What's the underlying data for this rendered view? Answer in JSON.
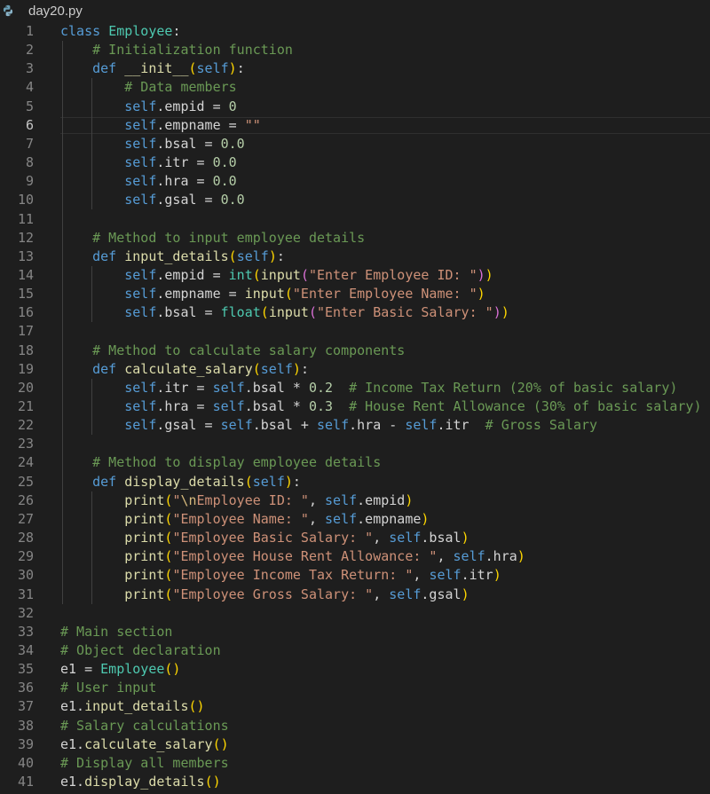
{
  "tab": {
    "filename": "day20.py",
    "icon": "python-icon"
  },
  "editor": {
    "language": "python",
    "active_line": 6,
    "lines": [
      {
        "n": "1",
        "tokens": [
          [
            "kw",
            "class"
          ],
          [
            "plain",
            " "
          ],
          [
            "cls",
            "Employee"
          ],
          [
            "plain",
            ":"
          ]
        ]
      },
      {
        "n": "2",
        "tokens": [
          [
            "plain",
            "    "
          ],
          [
            "cmt",
            "# Initialization function"
          ]
        ]
      },
      {
        "n": "3",
        "tokens": [
          [
            "plain",
            "    "
          ],
          [
            "kw",
            "def"
          ],
          [
            "plain",
            " "
          ],
          [
            "fn",
            "__init__"
          ],
          [
            "p1",
            "("
          ],
          [
            "slf",
            "self"
          ],
          [
            "p1",
            ")"
          ],
          [
            "plain",
            ":"
          ]
        ]
      },
      {
        "n": "4",
        "tokens": [
          [
            "plain",
            "        "
          ],
          [
            "cmt",
            "# Data members"
          ]
        ]
      },
      {
        "n": "5",
        "tokens": [
          [
            "plain",
            "        "
          ],
          [
            "slf",
            "self"
          ],
          [
            "plain",
            ".empid = "
          ],
          [
            "num",
            "0"
          ]
        ]
      },
      {
        "n": "6",
        "tokens": [
          [
            "plain",
            "        "
          ],
          [
            "slf",
            "self"
          ],
          [
            "plain",
            ".empname = "
          ],
          [
            "str",
            "\"\""
          ]
        ]
      },
      {
        "n": "7",
        "tokens": [
          [
            "plain",
            "        "
          ],
          [
            "slf",
            "self"
          ],
          [
            "plain",
            ".bsal = "
          ],
          [
            "num",
            "0.0"
          ]
        ]
      },
      {
        "n": "8",
        "tokens": [
          [
            "plain",
            "        "
          ],
          [
            "slf",
            "self"
          ],
          [
            "plain",
            ".itr = "
          ],
          [
            "num",
            "0.0"
          ]
        ]
      },
      {
        "n": "9",
        "tokens": [
          [
            "plain",
            "        "
          ],
          [
            "slf",
            "self"
          ],
          [
            "plain",
            ".hra = "
          ],
          [
            "num",
            "0.0"
          ]
        ]
      },
      {
        "n": "10",
        "tokens": [
          [
            "plain",
            "        "
          ],
          [
            "slf",
            "self"
          ],
          [
            "plain",
            ".gsal = "
          ],
          [
            "num",
            "0.0"
          ]
        ]
      },
      {
        "n": "11",
        "tokens": []
      },
      {
        "n": "12",
        "tokens": [
          [
            "plain",
            "    "
          ],
          [
            "cmt",
            "# Method to input employee details"
          ]
        ]
      },
      {
        "n": "13",
        "tokens": [
          [
            "plain",
            "    "
          ],
          [
            "kw",
            "def"
          ],
          [
            "plain",
            " "
          ],
          [
            "fn",
            "input_details"
          ],
          [
            "p1",
            "("
          ],
          [
            "slf",
            "self"
          ],
          [
            "p1",
            ")"
          ],
          [
            "plain",
            ":"
          ]
        ]
      },
      {
        "n": "14",
        "tokens": [
          [
            "plain",
            "        "
          ],
          [
            "slf",
            "self"
          ],
          [
            "plain",
            ".empid = "
          ],
          [
            "bi",
            "int"
          ],
          [
            "p1",
            "("
          ],
          [
            "fn",
            "input"
          ],
          [
            "p2",
            "("
          ],
          [
            "str",
            "\"Enter Employee ID: \""
          ],
          [
            "p2",
            ")"
          ],
          [
            "p1",
            ")"
          ]
        ]
      },
      {
        "n": "15",
        "tokens": [
          [
            "plain",
            "        "
          ],
          [
            "slf",
            "self"
          ],
          [
            "plain",
            ".empname = "
          ],
          [
            "fn",
            "input"
          ],
          [
            "p1",
            "("
          ],
          [
            "str",
            "\"Enter Employee Name: \""
          ],
          [
            "p1",
            ")"
          ]
        ]
      },
      {
        "n": "16",
        "tokens": [
          [
            "plain",
            "        "
          ],
          [
            "slf",
            "self"
          ],
          [
            "plain",
            ".bsal = "
          ],
          [
            "bi",
            "float"
          ],
          [
            "p1",
            "("
          ],
          [
            "fn",
            "input"
          ],
          [
            "p2",
            "("
          ],
          [
            "str",
            "\"Enter Basic Salary: \""
          ],
          [
            "p2",
            ")"
          ],
          [
            "p1",
            ")"
          ]
        ]
      },
      {
        "n": "17",
        "tokens": []
      },
      {
        "n": "18",
        "tokens": [
          [
            "plain",
            "    "
          ],
          [
            "cmt",
            "# Method to calculate salary components"
          ]
        ]
      },
      {
        "n": "19",
        "tokens": [
          [
            "plain",
            "    "
          ],
          [
            "kw",
            "def"
          ],
          [
            "plain",
            " "
          ],
          [
            "fn",
            "calculate_salary"
          ],
          [
            "p1",
            "("
          ],
          [
            "slf",
            "self"
          ],
          [
            "p1",
            ")"
          ],
          [
            "plain",
            ":"
          ]
        ]
      },
      {
        "n": "20",
        "tokens": [
          [
            "plain",
            "        "
          ],
          [
            "slf",
            "self"
          ],
          [
            "plain",
            ".itr = "
          ],
          [
            "slf",
            "self"
          ],
          [
            "plain",
            ".bsal * "
          ],
          [
            "num",
            "0.2"
          ],
          [
            "plain",
            "  "
          ],
          [
            "cmt",
            "# Income Tax Return (20% of basic salary)"
          ]
        ]
      },
      {
        "n": "21",
        "tokens": [
          [
            "plain",
            "        "
          ],
          [
            "slf",
            "self"
          ],
          [
            "plain",
            ".hra = "
          ],
          [
            "slf",
            "self"
          ],
          [
            "plain",
            ".bsal * "
          ],
          [
            "num",
            "0.3"
          ],
          [
            "plain",
            "  "
          ],
          [
            "cmt",
            "# House Rent Allowance (30% of basic salary)"
          ]
        ]
      },
      {
        "n": "22",
        "tokens": [
          [
            "plain",
            "        "
          ],
          [
            "slf",
            "self"
          ],
          [
            "plain",
            ".gsal = "
          ],
          [
            "slf",
            "self"
          ],
          [
            "plain",
            ".bsal + "
          ],
          [
            "slf",
            "self"
          ],
          [
            "plain",
            ".hra - "
          ],
          [
            "slf",
            "self"
          ],
          [
            "plain",
            ".itr  "
          ],
          [
            "cmt",
            "# Gross Salary"
          ]
        ]
      },
      {
        "n": "23",
        "tokens": []
      },
      {
        "n": "24",
        "tokens": [
          [
            "plain",
            "    "
          ],
          [
            "cmt",
            "# Method to display employee details"
          ]
        ]
      },
      {
        "n": "25",
        "tokens": [
          [
            "plain",
            "    "
          ],
          [
            "kw",
            "def"
          ],
          [
            "plain",
            " "
          ],
          [
            "fn",
            "display_details"
          ],
          [
            "p1",
            "("
          ],
          [
            "slf",
            "self"
          ],
          [
            "p1",
            ")"
          ],
          [
            "plain",
            ":"
          ]
        ]
      },
      {
        "n": "26",
        "tokens": [
          [
            "plain",
            "        "
          ],
          [
            "fn",
            "print"
          ],
          [
            "p1",
            "("
          ],
          [
            "str",
            "\""
          ],
          [
            "esc",
            "\\n"
          ],
          [
            "str",
            "Employee ID: \""
          ],
          [
            "plain",
            ", "
          ],
          [
            "slf",
            "self"
          ],
          [
            "plain",
            ".empid"
          ],
          [
            "p1",
            ")"
          ]
        ]
      },
      {
        "n": "27",
        "tokens": [
          [
            "plain",
            "        "
          ],
          [
            "fn",
            "print"
          ],
          [
            "p1",
            "("
          ],
          [
            "str",
            "\"Employee Name: \""
          ],
          [
            "plain",
            ", "
          ],
          [
            "slf",
            "self"
          ],
          [
            "plain",
            ".empname"
          ],
          [
            "p1",
            ")"
          ]
        ]
      },
      {
        "n": "28",
        "tokens": [
          [
            "plain",
            "        "
          ],
          [
            "fn",
            "print"
          ],
          [
            "p1",
            "("
          ],
          [
            "str",
            "\"Employee Basic Salary: \""
          ],
          [
            "plain",
            ", "
          ],
          [
            "slf",
            "self"
          ],
          [
            "plain",
            ".bsal"
          ],
          [
            "p1",
            ")"
          ]
        ]
      },
      {
        "n": "29",
        "tokens": [
          [
            "plain",
            "        "
          ],
          [
            "fn",
            "print"
          ],
          [
            "p1",
            "("
          ],
          [
            "str",
            "\"Employee House Rent Allowance: \""
          ],
          [
            "plain",
            ", "
          ],
          [
            "slf",
            "self"
          ],
          [
            "plain",
            ".hra"
          ],
          [
            "p1",
            ")"
          ]
        ]
      },
      {
        "n": "30",
        "tokens": [
          [
            "plain",
            "        "
          ],
          [
            "fn",
            "print"
          ],
          [
            "p1",
            "("
          ],
          [
            "str",
            "\"Employee Income Tax Return: \""
          ],
          [
            "plain",
            ", "
          ],
          [
            "slf",
            "self"
          ],
          [
            "plain",
            ".itr"
          ],
          [
            "p1",
            ")"
          ]
        ]
      },
      {
        "n": "31",
        "tokens": [
          [
            "plain",
            "        "
          ],
          [
            "fn",
            "print"
          ],
          [
            "p1",
            "("
          ],
          [
            "str",
            "\"Employee Gross Salary: \""
          ],
          [
            "plain",
            ", "
          ],
          [
            "slf",
            "self"
          ],
          [
            "plain",
            ".gsal"
          ],
          [
            "p1",
            ")"
          ]
        ]
      },
      {
        "n": "32",
        "tokens": []
      },
      {
        "n": "33",
        "tokens": [
          [
            "cmt",
            "# Main section"
          ]
        ]
      },
      {
        "n": "34",
        "tokens": [
          [
            "cmt",
            "# Object declaration"
          ]
        ]
      },
      {
        "n": "35",
        "tokens": [
          [
            "plain",
            "e1 = "
          ],
          [
            "cls",
            "Employee"
          ],
          [
            "p1",
            "()"
          ]
        ]
      },
      {
        "n": "36",
        "tokens": [
          [
            "cmt",
            "# User input"
          ]
        ]
      },
      {
        "n": "37",
        "tokens": [
          [
            "plain",
            "e1."
          ],
          [
            "fn",
            "input_details"
          ],
          [
            "p1",
            "()"
          ]
        ]
      },
      {
        "n": "38",
        "tokens": [
          [
            "cmt",
            "# Salary calculations"
          ]
        ]
      },
      {
        "n": "39",
        "tokens": [
          [
            "plain",
            "e1."
          ],
          [
            "fn",
            "calculate_salary"
          ],
          [
            "p1",
            "()"
          ]
        ]
      },
      {
        "n": "40",
        "tokens": [
          [
            "cmt",
            "# Display all members"
          ]
        ]
      },
      {
        "n": "41",
        "tokens": [
          [
            "plain",
            "e1."
          ],
          [
            "fn",
            "display_details"
          ],
          [
            "p1",
            "()"
          ]
        ]
      }
    ]
  }
}
